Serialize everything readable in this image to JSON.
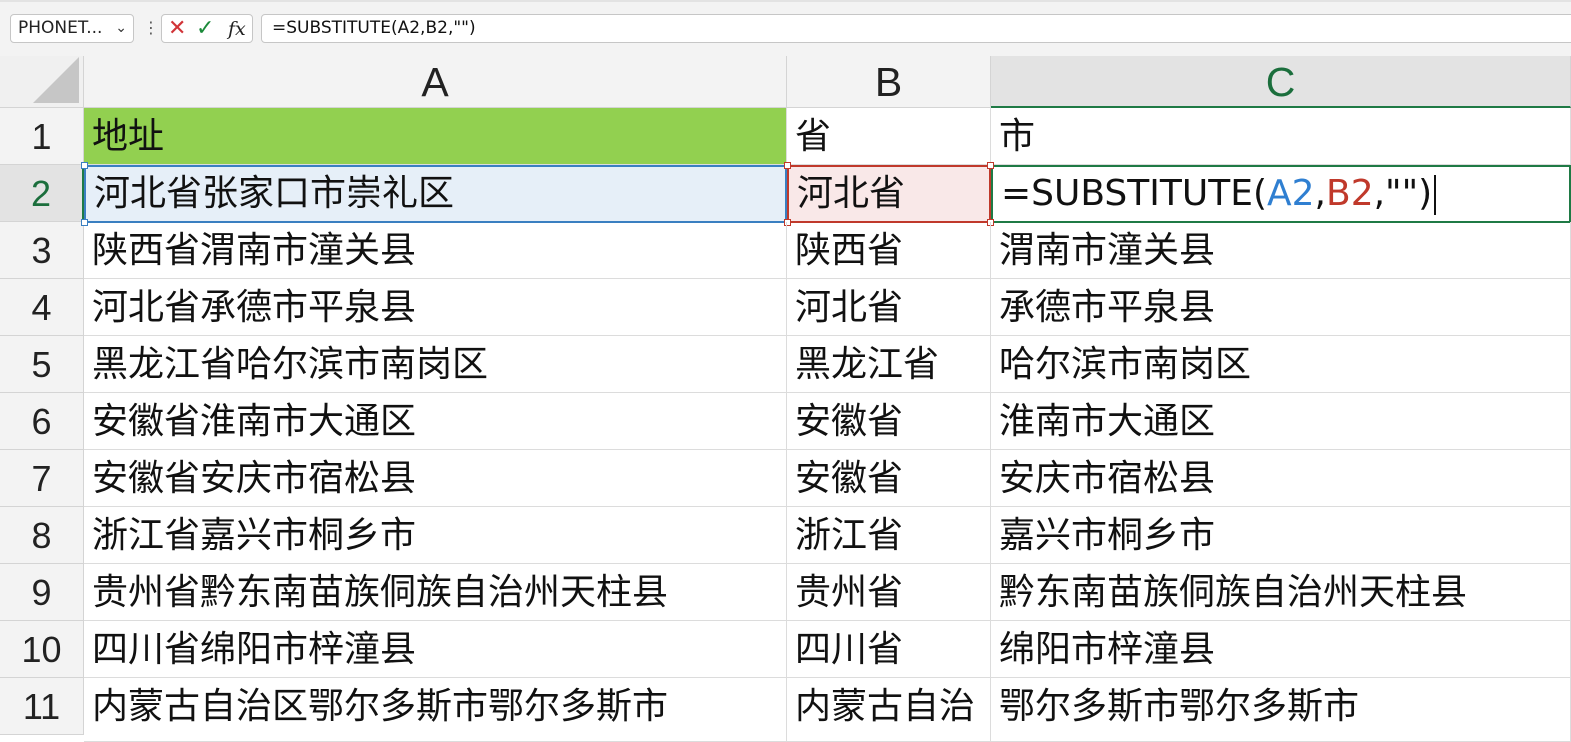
{
  "formula_bar": {
    "name_box": "PHONET...",
    "name_box_chevron": "⌄",
    "more_dots": "⋮",
    "cancel_glyph": "✕",
    "enter_glyph": "✓",
    "fx_label": "fx",
    "formula": "=SUBSTITUTE(A2,B2,\"\")"
  },
  "columns": [
    "A",
    "B",
    "C"
  ],
  "rows": [
    {
      "num": "1",
      "a": "地址",
      "b": "省",
      "c": "市"
    },
    {
      "num": "2",
      "a": "河北省张家口市崇礼区",
      "b": "河北省",
      "c": ""
    },
    {
      "num": "3",
      "a": "陕西省渭南市潼关县",
      "b": "陕西省",
      "c": "渭南市潼关县"
    },
    {
      "num": "4",
      "a": "河北省承德市平泉县",
      "b": "河北省",
      "c": "承德市平泉县"
    },
    {
      "num": "5",
      "a": "黑龙江省哈尔滨市南岗区",
      "b": "黑龙江省",
      "c": "哈尔滨市南岗区"
    },
    {
      "num": "6",
      "a": "安徽省淮南市大通区",
      "b": "安徽省",
      "c": "淮南市大通区"
    },
    {
      "num": "7",
      "a": "安徽省安庆市宿松县",
      "b": "安徽省",
      "c": "安庆市宿松县"
    },
    {
      "num": "8",
      "a": "浙江省嘉兴市桐乡市",
      "b": "浙江省",
      "c": "嘉兴市桐乡市"
    },
    {
      "num": "9",
      "a": "贵州省黔东南苗族侗族自治州天柱县",
      "b": "贵州省",
      "c": "黔东南苗族侗族自治州天柱县"
    },
    {
      "num": "10",
      "a": "四川省绵阳市梓潼县",
      "b": "四川省",
      "c": "绵阳市梓潼县"
    },
    {
      "num": "11",
      "a": "内蒙古自治区鄂尔多斯市鄂尔多斯市",
      "b": "内蒙古自治",
      "c": "鄂尔多斯市鄂尔多斯市"
    }
  ],
  "editing_cell": {
    "prefix": "=SUBSTITUTE(",
    "ref1": "A2",
    "sep1": ",",
    "ref2": "B2",
    "suffix": ",\"\")"
  },
  "colors": {
    "header_fill": "#92d050",
    "ref1_color": "#2f7fd1",
    "ref2_color": "#c0392b",
    "active_header": "#1b6e3c"
  }
}
